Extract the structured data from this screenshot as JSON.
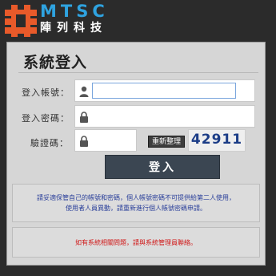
{
  "brand": {
    "logo_en": "MTSC",
    "logo_zh": "陣列科技",
    "logo_color": "#2fa3e0",
    "mark_color": "#e85a2a"
  },
  "login": {
    "title": "系統登入",
    "account_label": "登入帳號：",
    "password_label": "登入密碼：",
    "captcha_label": "驗證碼：",
    "account_value": "",
    "password_value": "",
    "captcha_value": "",
    "refresh_label": "重新整理",
    "captcha_code": "42911",
    "submit_label": "登入"
  },
  "notices": {
    "privacy_line1": "請妥適保管自己的帳號和密碼，個人帳號密碼不可提供給第二人使用，",
    "privacy_line2": "使用者人員異動，請重新進行個人帳號密碼申請。",
    "support": "如有系統相關問題，請與系統管理員聯絡。"
  },
  "icons": {
    "account": "user-icon",
    "password": "lock-icon",
    "captcha": "lock-icon"
  }
}
